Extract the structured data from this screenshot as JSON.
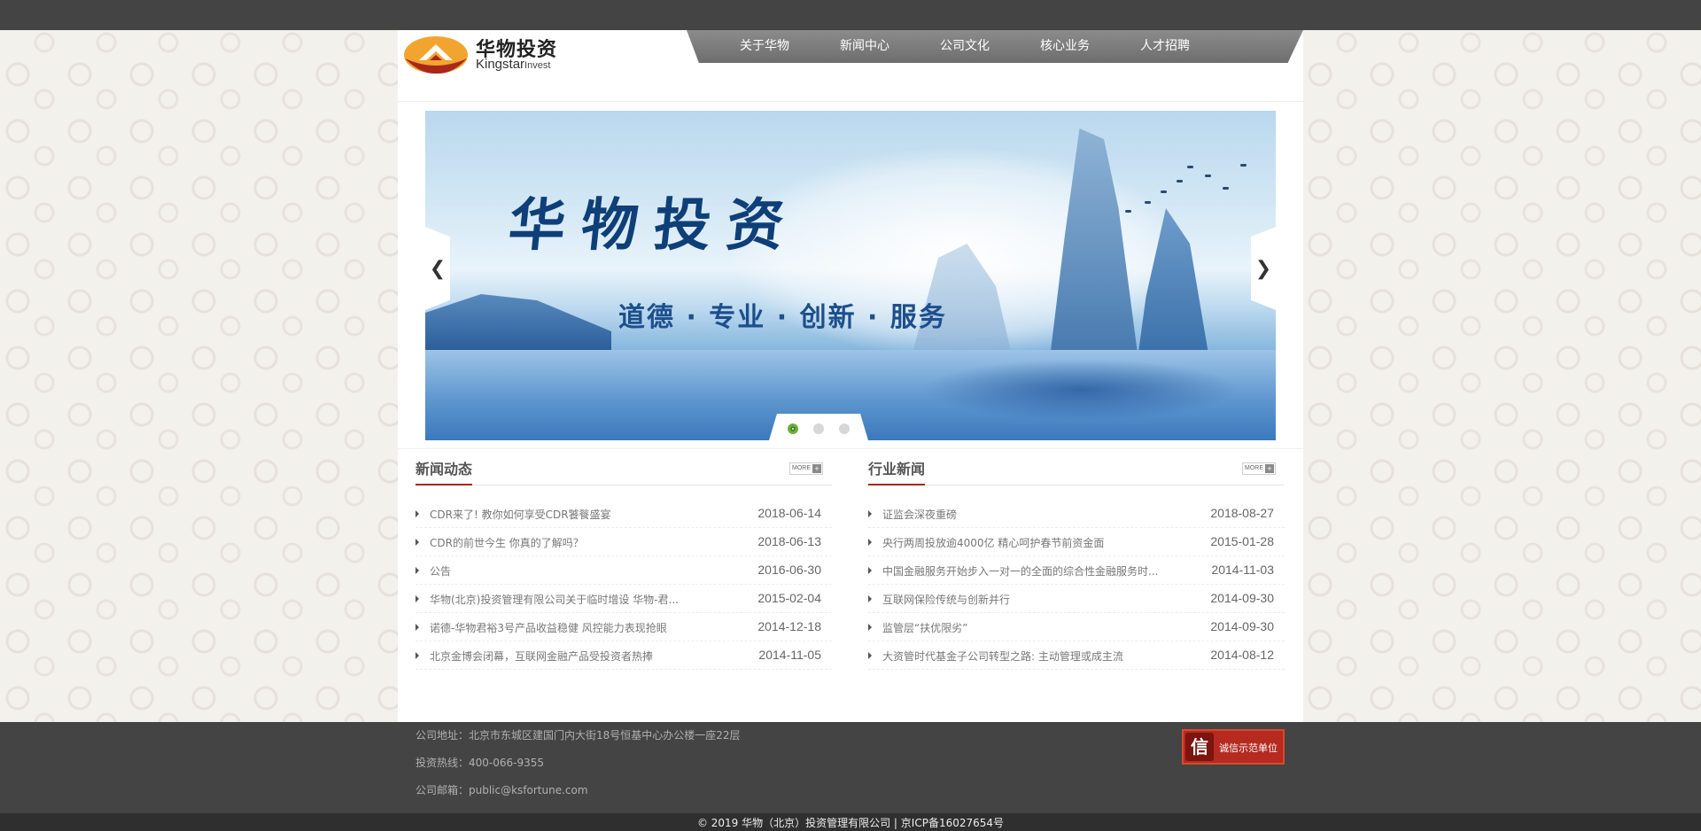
{
  "header": {
    "logo": {
      "name_cn": "华物投资",
      "name_en_main": "Kingstar",
      "name_en_sub": "Invest",
      "mark_colors": [
        "#f2a52e",
        "#a8271d"
      ]
    },
    "nav": [
      {
        "label": "关于华物"
      },
      {
        "label": "新闻中心"
      },
      {
        "label": "公司文化"
      },
      {
        "label": "核心业务"
      },
      {
        "label": "人才招聘"
      }
    ]
  },
  "banner": {
    "title": "华物投资",
    "slogan": "道德 · 专业 · 创新 · 服务",
    "prev_icon": "chevron-left-icon",
    "next_icon": "chevron-right-icon",
    "prev_glyph": "❮",
    "next_glyph": "❯",
    "slides": [
      {
        "active": true
      },
      {
        "active": false
      },
      {
        "active": false
      }
    ]
  },
  "news": {
    "left": {
      "title": "新闻动态",
      "more_label": "MORE",
      "more_icon": "+",
      "items": [
        {
          "text": "CDR来了! 教你如何享受CDR饕餮盛宴",
          "date": "2018-06-14"
        },
        {
          "text": "CDR的前世今生 你真的了解吗？",
          "date": "2018-06-13"
        },
        {
          "text": "公告",
          "date": "2016-06-30"
        },
        {
          "text": "华物(北京)投资管理有限公司关于临时增设 华物-君...",
          "date": "2015-02-04"
        },
        {
          "text": "诺德-华物君裕3号产品收益稳健 风控能力表现抢眼",
          "date": "2014-12-18"
        },
        {
          "text": "北京金博会闭幕，互联网金融产品受投资者热捧",
          "date": "2014-11-05"
        }
      ]
    },
    "right": {
      "title": "行业新闻",
      "more_label": "MORE",
      "more_icon": "+",
      "items": [
        {
          "text": "证监会深夜重磅",
          "date": "2018-08-27"
        },
        {
          "text": "央行两周投放逾4000亿 精心呵护春节前资金面",
          "date": "2015-01-28"
        },
        {
          "text": "中国金融服务开始步入一对一的全面的综合性金融服务时...",
          "date": "2014-11-03"
        },
        {
          "text": "互联网保险传统与创新并行",
          "date": "2014-09-30"
        },
        {
          "text": "监管层“扶优限劣”",
          "date": "2014-09-30"
        },
        {
          "text": "大资管时代基金子公司转型之路: 主动管理或成主流",
          "date": "2014-08-12"
        }
      ]
    }
  },
  "footer": {
    "address": "公司地址：北京市东城区建国门内大街18号恒基中心办公楼一座22层",
    "hotline": "投资热线：400-066-9355",
    "email": "公司邮箱：public@ksfortune.com",
    "badge_seal": "信",
    "badge_label": "诚信示范单位",
    "copyright": "© 2019 华物（北京）投资管理有限公司 | 京ICP备16027654号"
  },
  "colors": {
    "topbar": "#444444",
    "nav_bg": "#7a7a7a",
    "accent_red": "#a8261e",
    "footer_bg": "#444444",
    "dot_active": "#6fae3a"
  }
}
